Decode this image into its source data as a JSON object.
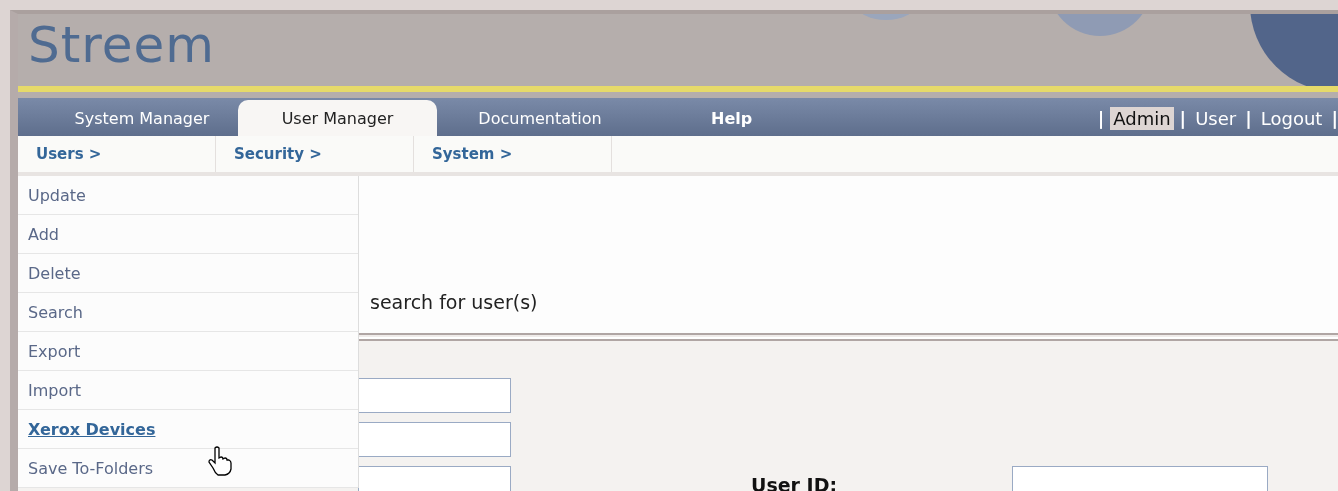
{
  "app": {
    "title": "Streem"
  },
  "tabs": [
    {
      "label": "System Manager",
      "kind": "tab",
      "selected": false
    },
    {
      "label": "User Manager",
      "kind": "tab",
      "selected": true
    },
    {
      "label": "Documentation",
      "kind": "tab",
      "selected": false
    },
    {
      "label": "Help",
      "kind": "link",
      "selected": false
    }
  ],
  "user_links": [
    {
      "label": "|",
      "kind": "separator"
    },
    {
      "label": "Admin",
      "kind": "link",
      "selected": true
    },
    {
      "label": "|",
      "kind": "separator"
    },
    {
      "label": "User",
      "kind": "link",
      "selected": false
    },
    {
      "label": "|",
      "kind": "separator"
    },
    {
      "label": "Logout",
      "kind": "link",
      "selected": false
    },
    {
      "label": "|",
      "kind": "separator"
    }
  ],
  "subnav": [
    "Users >",
    "Security >",
    "System >"
  ],
  "message": "search for user(s)",
  "menu": {
    "items": [
      {
        "label": "Update",
        "selected": false
      },
      {
        "label": "Add",
        "selected": false
      },
      {
        "label": "Delete",
        "selected": false
      },
      {
        "label": "Search",
        "selected": false
      },
      {
        "label": "Export",
        "selected": false
      },
      {
        "label": "Import",
        "selected": false
      },
      {
        "label": "Xerox Devices",
        "selected": true
      },
      {
        "label": "Save To-Folders",
        "selected": false
      }
    ]
  },
  "form": {
    "label": "User ID:"
  }
}
